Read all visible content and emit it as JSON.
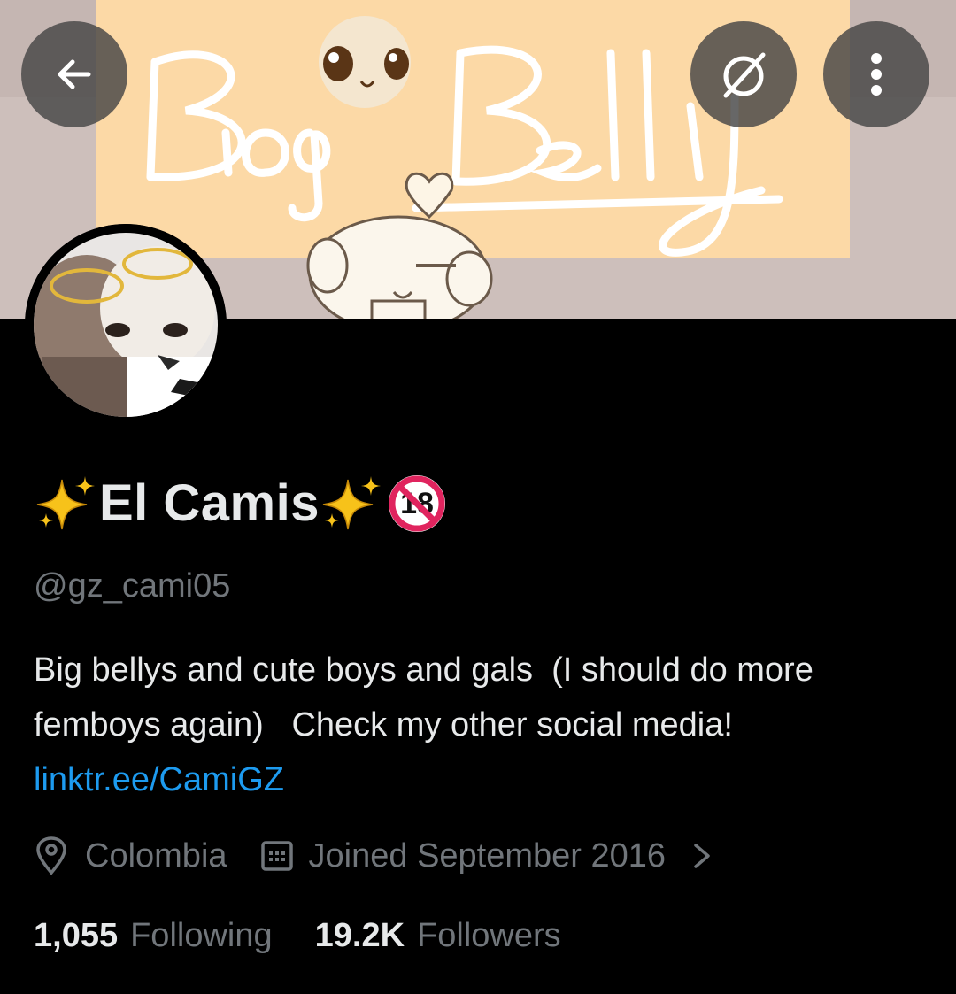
{
  "banner": {
    "text": "Big Belly",
    "colors": {
      "background": "#cfc1bd",
      "panel": "#fcd9a6",
      "lettering": "#ffffff"
    }
  },
  "header_actions": {
    "back_icon": "arrow-left-icon",
    "eye_slash_icon": "eye-slash-icon",
    "more_icon": "more-vertical-icon"
  },
  "profile": {
    "display_name": "El Camis",
    "badge": "18",
    "handle": "@gz_cami05",
    "bio_text": "Big bellys and cute boys and gals  (I should do more femboys again)   Check my other social media! ",
    "bio_link": "linktr.ee/CamiGZ",
    "location": "Colombia",
    "joined": "Joined September 2016",
    "following_count": "1,055",
    "following_label": "Following",
    "followers_count": "19.2K",
    "followers_label": "Followers"
  },
  "colors": {
    "background": "#000000",
    "primary_text": "#e7e9ea",
    "secondary_text": "#71767b",
    "link": "#1d9bf0",
    "badge_red": "#e0245e"
  }
}
